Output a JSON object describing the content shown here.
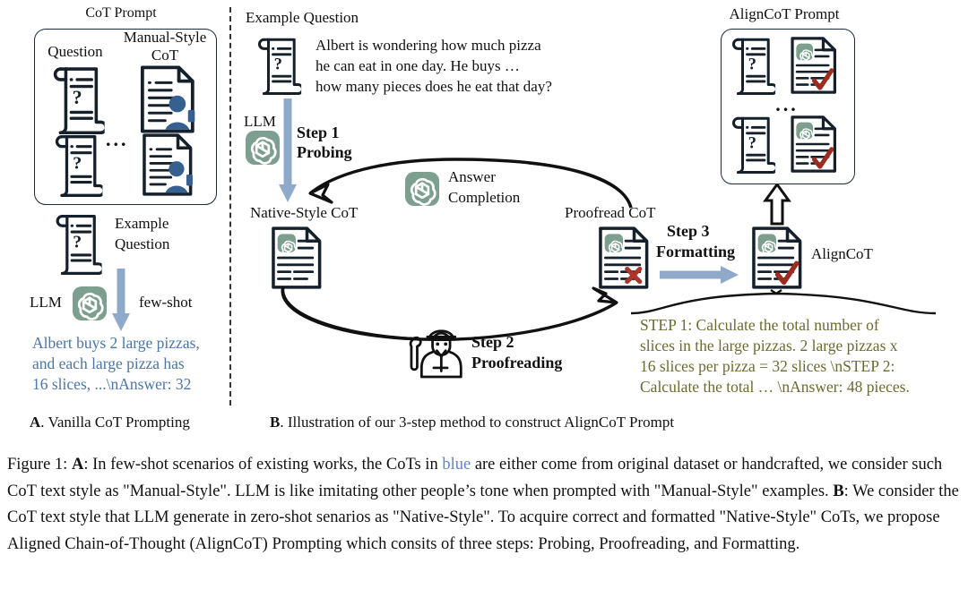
{
  "figure": {
    "panelA": {
      "title": "CoT Prompt",
      "col_question_label": "Question",
      "col_cot_label_line1": "Manual-Style",
      "col_cot_label_line2": "CoT",
      "ellipsis": "...",
      "example_question_line1": "Example",
      "example_question_line2": "Question",
      "llm_label": "LLM",
      "fewshot_label": "few-shot",
      "cot_output_line1": "Albert buys 2 large pizzas,",
      "cot_output_line2": "and each large pizza has",
      "cot_output_line3": "16 slices, ...\\nAnswer: 32",
      "subcaption_bold": "A",
      "subcaption_rest": ". Vanilla CoT Prompting"
    },
    "panelB": {
      "example_question_title": "Example Question",
      "question_line1": "Albert is wondering how much pizza",
      "question_line2": "he can eat in one day. He buys …",
      "question_line3": "how many pieces does he eat that day?",
      "llm_label": "LLM",
      "step1_line1": "Step 1",
      "step1_line2": "Probing",
      "native_cot_label": "Native-Style CoT",
      "answer_completion_line1": "Answer",
      "answer_completion_line2": "Completion",
      "proofread_cot_label": "Proofread CoT",
      "step2_line1": "Step 2",
      "step2_line2": "Proofreading",
      "step3_line1": "Step 3",
      "step3_line2": "Formatting",
      "aligncot_label": "AlignCoT",
      "aligncot_prompt_title": "AlignCoT Prompt",
      "ellipsis": "...",
      "aligncot_text_line1": "STEP 1: Calculate the total number of",
      "aligncot_text_line2": "slices in the large pizzas. 2 large pizzas x",
      "aligncot_text_line3": "16 slices per pizza = 32 slices \\nSTEP 2:",
      "aligncot_text_line4": "Calculate the total … \\nAnswer: 48 pieces.",
      "subcaption_bold": "B",
      "subcaption_rest": ". Illustration of our 3-step method to construct AlignCoT Prompt"
    },
    "caption": {
      "prefix": "Figure 1:  ",
      "a_bold": "A",
      "seg1": ": In few-shot scenarios of existing works, the CoTs in ",
      "blue_word": "blue",
      "seg2": " are either come from original dataset or handcrafted, we consider such CoT text style as \"Manual-Style\". LLM is like imitating other people’s tone when prompted with \"Manual-Style\" examples. ",
      "b_bold": "B",
      "seg3": ": We consider the CoT text style that LLM generate in zero-shot senarios as \"Native-Style\". To acquire correct and formatted \"Native-Style\" CoTs, we propose Aligned Chain-of-Thought (AlignCoT) Prompting which consits of three steps: Probing, Proofreading, and Formatting."
    },
    "colors": {
      "openai_green": "#7d9f90",
      "arrow_blue": "#8ea9c9",
      "person_blue": "#36608f",
      "cot_blue_text": "#4a76a8",
      "olive_text": "#6b6b2e",
      "check_red": "#9e2b20",
      "cross_red": "#b0332a",
      "outline": "#15202b"
    },
    "icons": {
      "scroll": "scroll-question-icon",
      "doc_person": "document-person-icon",
      "doc_openai": "document-openai-icon",
      "doc_openai_cross": "document-openai-cross-icon",
      "doc_openai_check": "document-openai-check-icon",
      "openai_logo": "openai-logo-icon",
      "worker": "worker-proofreading-icon"
    }
  }
}
